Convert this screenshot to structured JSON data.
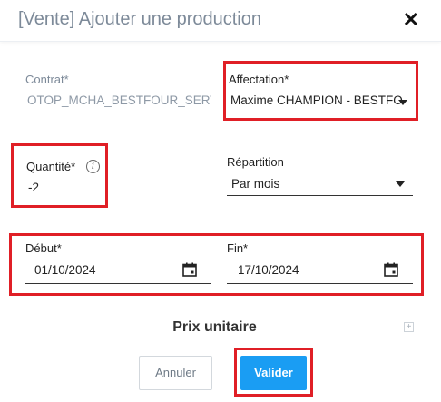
{
  "header": {
    "title": "[Vente] Ajouter une production",
    "close_label": "✕"
  },
  "form": {
    "contrat": {
      "label": "Contrat*",
      "value": "OTOP_MCHA_BESTFOUR_SERVICES"
    },
    "affectation": {
      "label": "Affectation*",
      "value": "Maxime CHAMPION - BESTFOUR"
    },
    "quantite": {
      "label": "Quantité*",
      "value": "-2",
      "info_icon": "i"
    },
    "repartition": {
      "label": "Répartition",
      "value": "Par mois"
    },
    "debut": {
      "label": "Début*",
      "value": "01/10/2024"
    },
    "fin": {
      "label": "Fin*",
      "value": "17/10/2024"
    }
  },
  "section": {
    "title": "Prix unitaire",
    "toggle": "+"
  },
  "buttons": {
    "cancel": "Annuler",
    "submit": "Valider"
  },
  "colors": {
    "highlight": "#e01f26",
    "primary": "#1a9df3",
    "title_gray": "#7d8a99"
  }
}
